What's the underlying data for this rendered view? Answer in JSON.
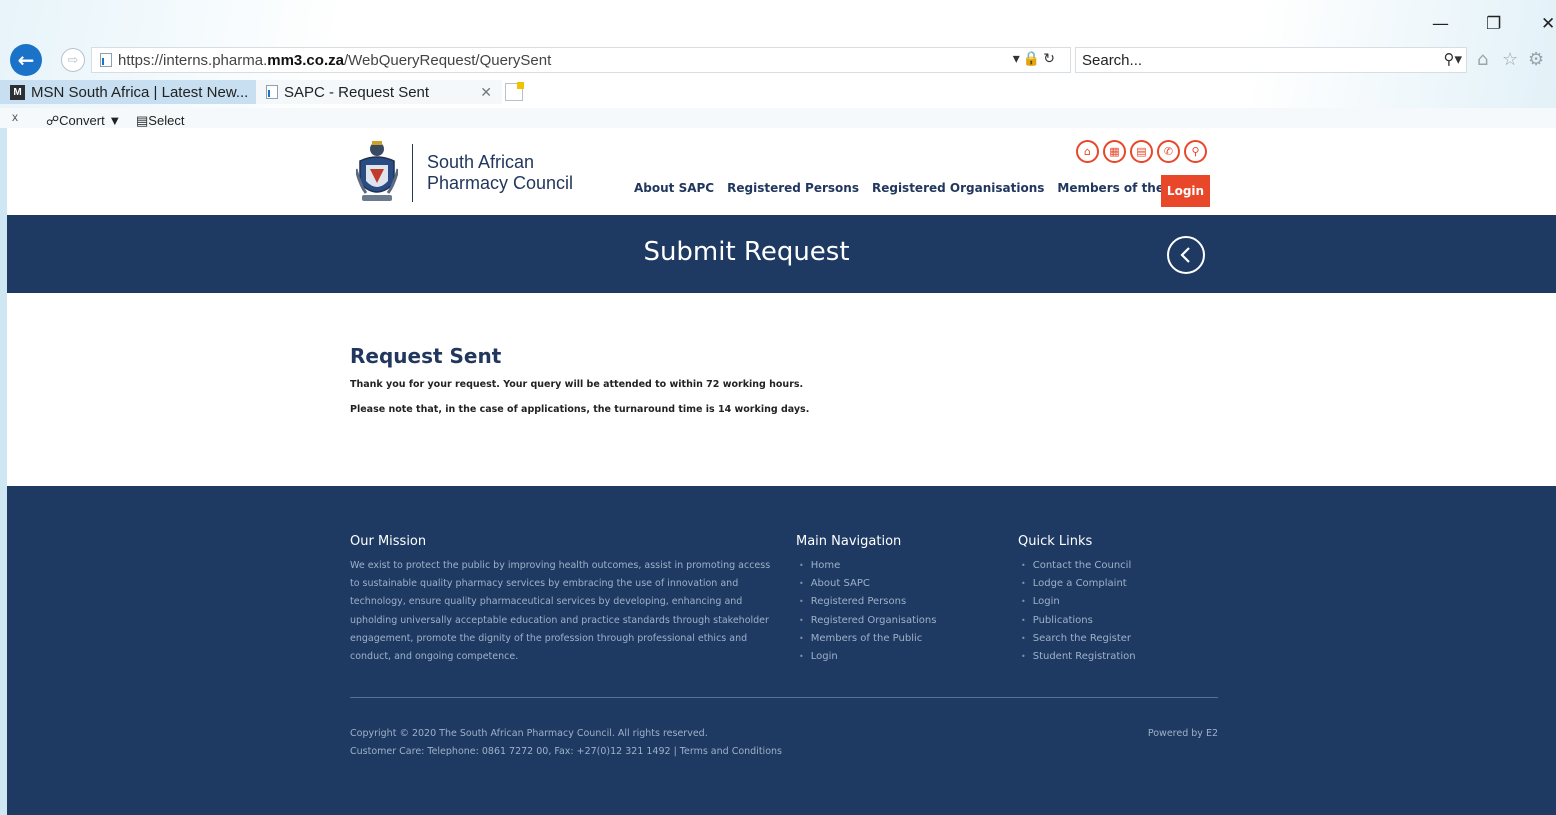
{
  "browser": {
    "url_prefix": "https://interns.pharma.",
    "url_domain": "mm3.co.za",
    "url_path": "/WebQueryRequest/QuerySent",
    "search_placeholder": "Search...",
    "tabs": [
      {
        "label": "MSN South Africa | Latest New..."
      },
      {
        "label": "SAPC - Request Sent"
      }
    ],
    "commands": {
      "close": "x",
      "convert": "Convert",
      "select": "Select"
    },
    "window_controls": {
      "minimize": "—",
      "restore": "❐",
      "close": "✕"
    }
  },
  "header": {
    "logo_line1": "South African",
    "logo_line2": "Pharmacy Council",
    "nav": [
      "About SAPC",
      "Registered Persons",
      "Registered Organisations",
      "Members of the Public"
    ],
    "login_label": "Login",
    "icons": [
      "home-icon",
      "calendar-icon",
      "book-icon",
      "phone-icon",
      "search-icon"
    ]
  },
  "banner": {
    "title": "Submit Request"
  },
  "content": {
    "heading": "Request Sent",
    "line1": "Thank you for your request. Your query will be attended to within 72 working hours.",
    "line2": "Please note that, in the case of applications, the turnaround time is 14 working days."
  },
  "footer": {
    "mission_title": "Our Mission",
    "mission_text": "We exist to protect the public by improving health outcomes, assist in promoting access to sustainable quality pharmacy services by embracing the use of innovation and technology, ensure quality pharmaceutical services by developing, enhancing and upholding universally acceptable education and practice standards through stakeholder engagement, promote the dignity of the profession through professional ethics and conduct, and ongoing competence.",
    "nav_title": "Main Navigation",
    "nav_items": [
      "Home",
      "About SAPC",
      "Registered Persons",
      "Registered Organisations",
      "Members of the Public",
      "Login"
    ],
    "links_title": "Quick Links",
    "link_items": [
      "Contact the Council",
      "Lodge a Complaint",
      "Login",
      "Publications",
      "Search the Register",
      "Student Registration"
    ],
    "copyright": "Copyright © 2020 The South African Pharmacy Council. All rights reserved.",
    "customer_care": "Customer Care: Telephone: 0861 7272 00, Fax: +27(0)12 321 1492 | Terms and Conditions",
    "powered_by": "Powered by E2"
  },
  "colors": {
    "navy": "#1e3a63",
    "accent": "#e8472a",
    "brand_text": "#22375e"
  }
}
